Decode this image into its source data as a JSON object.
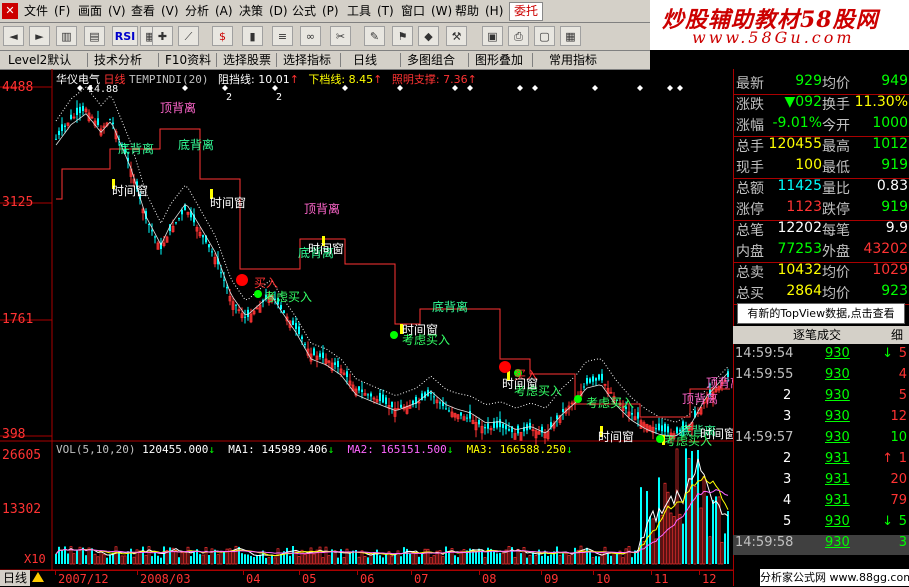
{
  "menu": {
    "items": [
      "文件",
      "画面",
      "查看",
      "分析",
      "决策",
      "公式",
      "工具",
      "窗口",
      "帮助"
    ],
    "special": "委托"
  },
  "brand": {
    "line1": "炒股辅助教材58股网",
    "line2": "www.58Gu.com"
  },
  "toolbar": {
    "buttons": [
      "back-icon",
      "forward-icon",
      "kline-icon",
      "tick-icon",
      "rsi-icon",
      "grid-icon",
      "cross-icon",
      "ruler-icon",
      "dollar-icon",
      "bars-icon",
      "quotes-icon",
      "binoculars-icon",
      "scissors-icon",
      "pen-icon",
      "flag-icon",
      "alert-icon",
      "tools-icon",
      "stamp-icon",
      "print-icon",
      "window-icon",
      "calc-icon",
      "lock-icon",
      "book-icon"
    ],
    "rsi_label": "RSI"
  },
  "tabs": [
    "Level2默认",
    "技术分析",
    "F10资料",
    "选择股票",
    "选择指标",
    "日线",
    "多图组合",
    "图形叠加",
    "常用指标"
  ],
  "chart": {
    "stock_name": "华仪电气",
    "period": "日线",
    "indicator": "TEMPINDI(20)",
    "resist_label": "阻挡线:",
    "resist_value": "10.01",
    "lower_label": "下档线:",
    "lower_value": "8.45",
    "support_label": "照明支撑:",
    "support_value": "7.36",
    "y_labels": [
      "4488",
      "3125",
      "1761",
      "398"
    ],
    "vol_y_labels": [
      "26605",
      "13302"
    ],
    "x1_label": "X10",
    "top_marks": [
      "14.88",
      "2",
      "2"
    ],
    "annotations": [
      {
        "text": "顶背离",
        "color": "#ff66cc"
      },
      {
        "text": "底背离",
        "color": "#33ff99"
      },
      {
        "text": "底背离",
        "color": "#33ff99"
      },
      {
        "text": "时间窗",
        "color": "#ffffff"
      },
      {
        "text": "时间窗",
        "color": "#ffffff"
      },
      {
        "text": "买入",
        "color": "#ff3333"
      },
      {
        "text": "考虑买入",
        "color": "#33ff66"
      },
      {
        "text": "顶背离",
        "color": "#ff66cc"
      },
      {
        "text": "底背离",
        "color": "#33ff99"
      },
      {
        "text": "时间窗",
        "color": "#ffffff"
      },
      {
        "text": "底背离",
        "color": "#33ff99"
      },
      {
        "text": "时间窗",
        "color": "#ffffff"
      },
      {
        "text": "考虑买入",
        "color": "#33ff66"
      },
      {
        "text": "买入",
        "color": "#ff3333"
      },
      {
        "text": "考虑买入",
        "color": "#33ff66"
      },
      {
        "text": "时间窗",
        "color": "#ffffff"
      },
      {
        "text": "考虑买入",
        "color": "#33ff66"
      },
      {
        "text": "时间窗",
        "color": "#ffffff"
      },
      {
        "text": "底背离",
        "color": "#33ff99"
      },
      {
        "text": "顶背离",
        "color": "#ff66cc"
      },
      {
        "text": "顶背离",
        "color": "#ff66cc"
      },
      {
        "text": "时间窗",
        "color": "#ffffff"
      },
      {
        "text": "考虑买入",
        "color": "#33ff66"
      }
    ],
    "vol": {
      "label": "VOL(5,10,20)",
      "value": "120455.000",
      "ma1": "MA1: 145989.406",
      "ma2": "MA2: 165151.500",
      "ma3": "MA3: 166588.250"
    },
    "dates": [
      "2007/12",
      "2008/03",
      "04",
      "05",
      "06",
      "07",
      "08",
      "09",
      "10",
      "11",
      "12"
    ],
    "day_button": "日线"
  },
  "quote": {
    "rows": [
      {
        "l1": "最新",
        "v1": "929",
        "c1": "#00ff00",
        "l2": "均价",
        "v2": "949",
        "c2": "#00ff00"
      },
      {
        "l1": "涨跌",
        "v1": "▼092",
        "c1": "#00ff00",
        "l2": "换手",
        "v2": "11.30%",
        "c2": "#ffff00"
      },
      {
        "l1": "涨幅",
        "v1": "-9.01%",
        "c1": "#00ff00",
        "l2": "今开",
        "v2": "1000",
        "c2": "#00ff00"
      },
      {
        "l1": "总手",
        "v1": "120455",
        "c1": "#ffff00",
        "l2": "最高",
        "v2": "1012",
        "c2": "#00ff00"
      },
      {
        "l1": "现手",
        "v1": "100",
        "c1": "#ffff00",
        "l2": "最低",
        "v2": "919",
        "c2": "#00ff00"
      },
      {
        "l1": "总额",
        "v1": "11425",
        "c1": "#00ffff",
        "l2": "量比",
        "v2": "0.83",
        "c2": "#ffffff"
      },
      {
        "l1": "涨停",
        "v1": "1123",
        "c1": "#ff3333",
        "l2": "跌停",
        "v2": "919",
        "c2": "#00ff00"
      },
      {
        "l1": "总笔",
        "v1": "12202",
        "c1": "#ffffff",
        "l2": "每笔",
        "v2": "9.9",
        "c2": "#ffffff"
      },
      {
        "l1": "内盘",
        "v1": "77253",
        "c1": "#00ff00",
        "l2": "外盘",
        "v2": "43202",
        "c2": "#ff3333"
      },
      {
        "l1": "总卖",
        "v1": "10432",
        "c1": "#ffff00",
        "l2": "均价",
        "v2": "1029",
        "c2": "#ff3333"
      },
      {
        "l1": "总买",
        "v1": "2864",
        "c1": "#ffff00",
        "l2": "均价",
        "v2": "923",
        "c2": "#00ff00"
      }
    ],
    "topview": "有新的TopView数据,点击查看"
  },
  "ticks": {
    "header": "逐笔成交",
    "header_right": "细",
    "rows": [
      {
        "t": "14:59:54",
        "p": "930",
        "arrow": "↓",
        "arrow_color": "#00ff00",
        "v": "5",
        "vc": "#ff3333"
      },
      {
        "t": "14:59:55",
        "p": "930",
        "arrow": "",
        "arrow_color": "#00ff00",
        "v": "4",
        "vc": "#ff3333"
      },
      {
        "t": "2",
        "p": "930",
        "arrow": "",
        "arrow_color": "#00ff00",
        "v": "5",
        "vc": "#ff3333"
      },
      {
        "t": "3",
        "p": "930",
        "arrow": "",
        "arrow_color": "#00ff00",
        "v": "12",
        "vc": "#ff3333"
      },
      {
        "t": "14:59:57",
        "p": "930",
        "arrow": "",
        "arrow_color": "#00ff00",
        "v": "10",
        "vc": "#00ff00"
      },
      {
        "t": "2",
        "p": "931",
        "arrow": "↑",
        "arrow_color": "#ff3333",
        "v": "1",
        "vc": "#ff3333"
      },
      {
        "t": "3",
        "p": "931",
        "arrow": "",
        "arrow_color": "#00ff00",
        "v": "20",
        "vc": "#ff3333"
      },
      {
        "t": "4",
        "p": "931",
        "arrow": "",
        "arrow_color": "#00ff00",
        "v": "79",
        "vc": "#ff3333"
      },
      {
        "t": "5",
        "p": "930",
        "arrow": "↓",
        "arrow_color": "#00ff00",
        "v": "5",
        "vc": "#00ff00"
      },
      {
        "t": "14:59:58",
        "p": "930",
        "arrow": "",
        "arrow_color": "#00ff00",
        "v": "3",
        "vc": "#00ff00"
      }
    ]
  },
  "watermark": "分析家公式网 www.88gg.com"
}
